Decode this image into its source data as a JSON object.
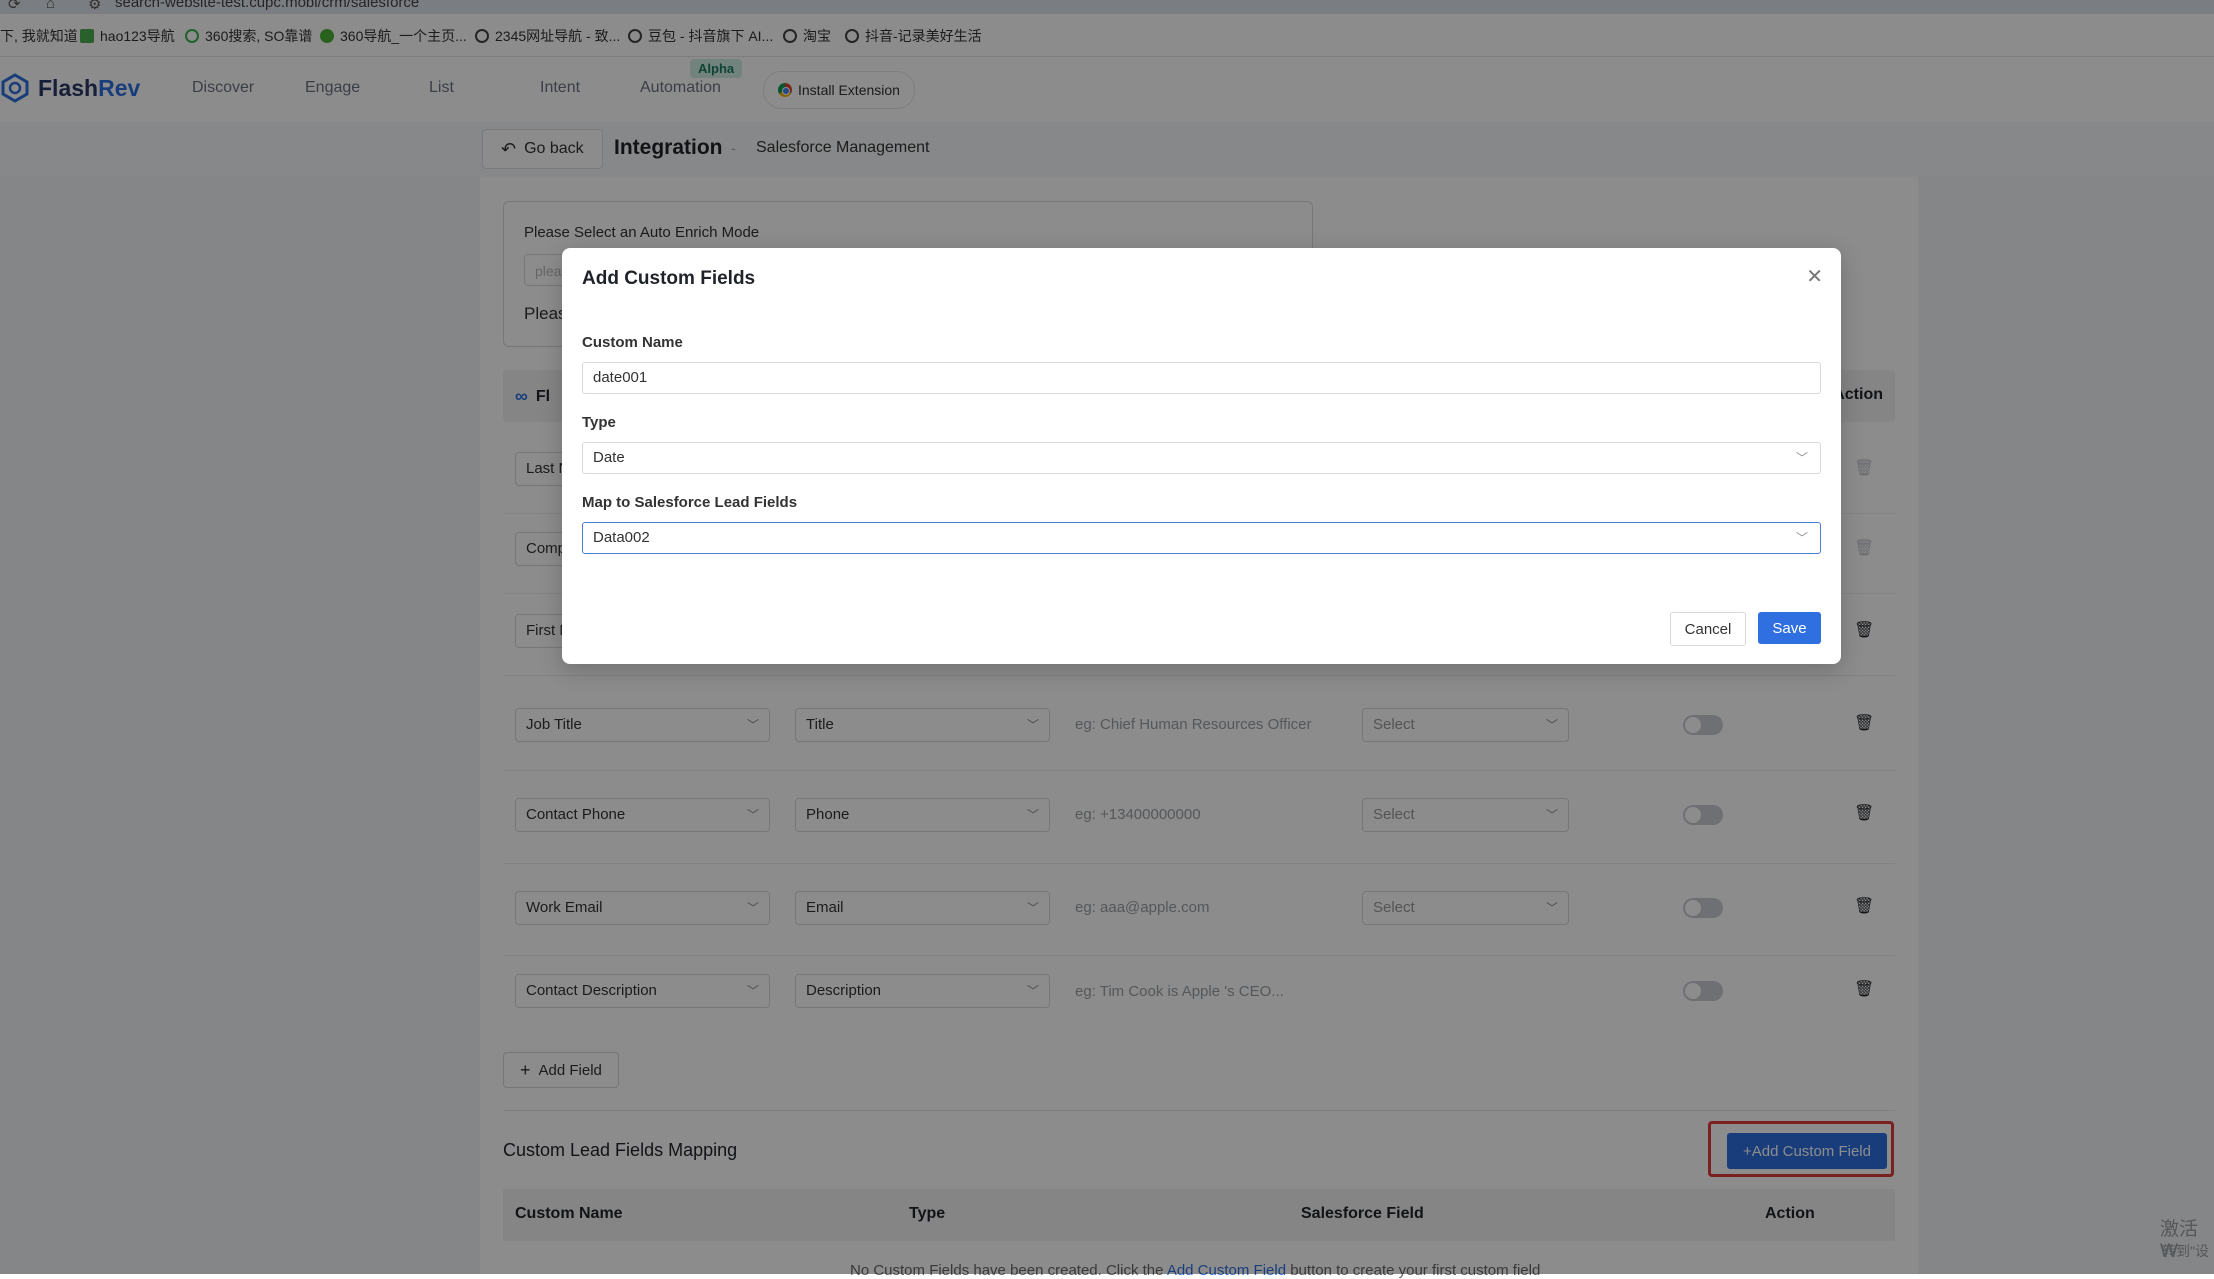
{
  "browser": {
    "url": "search-website-test.cupc.mobi/crm/salesforce",
    "bookmarks": [
      {
        "label": "下, 我就知道",
        "color": "#e8a23c"
      },
      {
        "label": "hao123导航",
        "color": "#4caf50"
      },
      {
        "label": "360搜索, SO靠谱",
        "color": "#3fb34f"
      },
      {
        "label": "360导航_一个主页...",
        "color": "#49b236"
      },
      {
        "label": "2345网址导航 - 致...",
        "color": "#444444"
      },
      {
        "label": "豆包 - 抖音旗下 AI...",
        "color": "#444444"
      },
      {
        "label": "淘宝",
        "color": "#444444"
      },
      {
        "label": "抖音-记录美好生活",
        "color": "#444444"
      }
    ]
  },
  "header": {
    "brand_a": "Flash",
    "brand_b": "Rev",
    "nav": [
      "Discover",
      "Engage",
      "List",
      "Intent",
      "Automation"
    ],
    "alpha_badge": "Alpha",
    "install_extension": "Install Extension"
  },
  "subheader": {
    "go_back": "Go back",
    "title": "Integration",
    "separator": "-",
    "breadcrumb": "Salesforce Management"
  },
  "auto_enrich": {
    "label": "Please Select an Auto Enrich Mode",
    "placeholder": "plea",
    "notice": "Pleas"
  },
  "mapping_table": {
    "col_first": "Fl",
    "col_action": "Action",
    "rows": [
      {
        "field": "Last N",
        "sf": "",
        "example": "",
        "select": ""
      },
      {
        "field": "Comp",
        "sf": "",
        "example": "",
        "select": ""
      },
      {
        "field": "First N",
        "sf": "",
        "example": "",
        "select": ""
      },
      {
        "field": "Job Title",
        "sf": "Title",
        "example": "eg: Chief Human Resources Officer",
        "select": "Select"
      },
      {
        "field": "Contact Phone",
        "sf": "Phone",
        "example": "eg: +13400000000",
        "select": "Select"
      },
      {
        "field": "Work Email",
        "sf": "Email",
        "example": "eg: aaa@apple.com",
        "select": "Select"
      },
      {
        "field": "Contact Description",
        "sf": "Description",
        "example": "eg: Tim Cook is Apple 's CEO...",
        "select": ""
      }
    ],
    "add_field": "Add Field"
  },
  "custom_section": {
    "title": "Custom Lead Fields Mapping",
    "add_button": "+Add Custom Field",
    "columns": [
      "Custom Name",
      "Type",
      "Salesforce Field",
      "Action"
    ],
    "empty_text_a": "No Custom Fields have been created. Click the ",
    "empty_link": "Add Custom Field",
    "empty_text_b": " button to create your first custom field"
  },
  "modal": {
    "title": "Add Custom Fields",
    "custom_name_label": "Custom Name",
    "custom_name_value": "date001",
    "type_label": "Type",
    "type_value": "Date",
    "map_label": "Map to Salesforce Lead Fields",
    "map_value": "Data002",
    "cancel": "Cancel",
    "save": "Save"
  },
  "watermark": {
    "line1": "激活 W",
    "line2": "转到\"设"
  }
}
